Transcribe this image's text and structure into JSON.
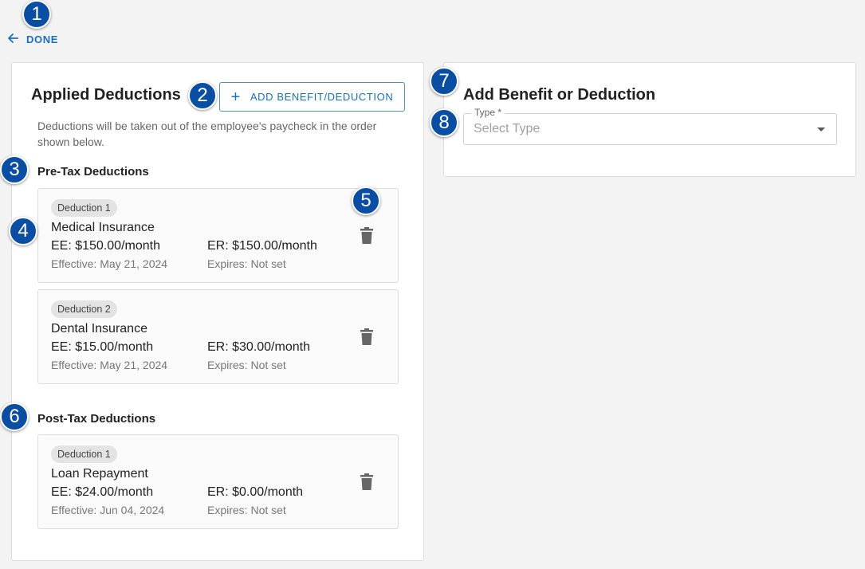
{
  "nav": {
    "done_label": "DONE"
  },
  "markers": [
    "1",
    "2",
    "3",
    "4",
    "5",
    "6",
    "7",
    "8"
  ],
  "applied": {
    "title": "Applied Deductions",
    "add_button_label": "ADD BENEFIT/DEDUCTION",
    "helper_text": "Deductions will be taken out of the employee's paycheck in the order shown below.",
    "pre_tax": {
      "title": "Pre-Tax Deductions",
      "items": [
        {
          "chip": "Deduction 1",
          "name": "Medical Insurance",
          "ee": "EE: $150.00/month",
          "er": "ER: $150.00/month",
          "effective": "Effective: May 21, 2024",
          "expires": "Expires: Not set"
        },
        {
          "chip": "Deduction 2",
          "name": "Dental Insurance",
          "ee": "EE: $15.00/month",
          "er": "ER: $30.00/month",
          "effective": "Effective: May 21, 2024",
          "expires": "Expires: Not set"
        }
      ]
    },
    "post_tax": {
      "title": "Post-Tax Deductions",
      "items": [
        {
          "chip": "Deduction 1",
          "name": "Loan Repayment",
          "ee": "EE: $24.00/month",
          "er": "ER: $0.00/month",
          "effective": "Effective: Jun 04, 2024",
          "expires": "Expires: Not set"
        }
      ]
    }
  },
  "add_form": {
    "title": "Add Benefit or Deduction",
    "type_label": "Type *",
    "type_placeholder": "Select Type"
  },
  "colors": {
    "accent": "#1b6fb5",
    "marker": "#0a4ea3"
  },
  "icons": {
    "back": "arrow-left-icon",
    "add": "plus-icon",
    "delete": "trash-icon",
    "dropdown": "caret-down-icon"
  }
}
